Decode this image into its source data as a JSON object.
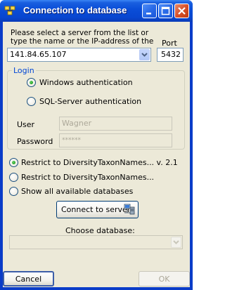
{
  "window": {
    "title": "Connection to database"
  },
  "server": {
    "instructions": "Please select a server from the list or type the name or the IP-address of the server",
    "address": "141.84.65.107",
    "port_label": "Port",
    "port": "5432"
  },
  "login": {
    "group_title": "Login",
    "windows_auth_label": "Windows authentication",
    "sql_auth_label": "SQL-Server authentication",
    "selected": "windows",
    "user_label": "User",
    "user_value": "Wagner",
    "password_label": "Password",
    "password_value": "******"
  },
  "restrict": {
    "option_1": "Restrict to DiversityTaxonNames... v. 2.1",
    "option_2": "Restrict to DiversityTaxonNames...",
    "option_3": "Show all available databases",
    "selected": 1
  },
  "connect_button": "Connect to server",
  "database": {
    "choose_label": "Choose database:",
    "value": ""
  },
  "footer": {
    "cancel_label": "Cancel",
    "ok_label": "OK"
  },
  "colors": {
    "titlebar": "#0a4ed8",
    "client_bg": "#ece9d8",
    "group_title": "#0046d5"
  }
}
